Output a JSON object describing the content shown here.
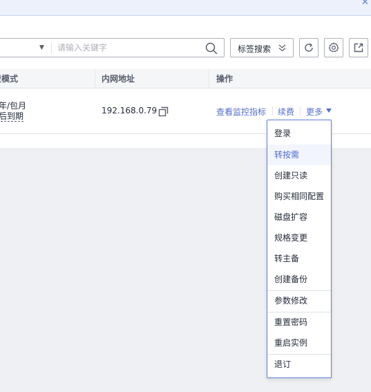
{
  "search": {
    "placeholder": "请输入关键字",
    "tag_search_label": "标签搜索"
  },
  "table": {
    "headers": {
      "billing": "计费模式",
      "private_ip": "内网地址",
      "operation": "操作"
    },
    "row": {
      "billing_line1": "包年/包月",
      "billing_line2": "天后到期",
      "private_ip": "192.168.0.79",
      "ops": {
        "monitor": "查看监控指标",
        "renew": "续费",
        "more": "更多"
      }
    }
  },
  "menu": {
    "items": [
      {
        "label": "登录"
      },
      {
        "label": "转按需"
      },
      {
        "label": "创建只读"
      },
      {
        "label": "购买相同配置"
      },
      {
        "label": "磁盘扩容"
      },
      {
        "label": "规格变更"
      },
      {
        "label": "转主备"
      },
      {
        "label": "创建备份"
      },
      {
        "label": "参数修改"
      },
      {
        "label": "重置密码"
      },
      {
        "label": "重启实例"
      },
      {
        "label": "退订"
      }
    ],
    "active_index": 1
  },
  "colors": {
    "accent": "#526ecc",
    "menu_border": "#5e7ce0",
    "text": "#252b3a",
    "page_bg": "#eff0f3"
  },
  "icons": [
    "close-icon",
    "chevron-down-icon",
    "search-icon",
    "double-chevron-down-icon",
    "refresh-icon",
    "gear-icon",
    "export-icon",
    "copy-icon",
    "caret-down-icon"
  ]
}
